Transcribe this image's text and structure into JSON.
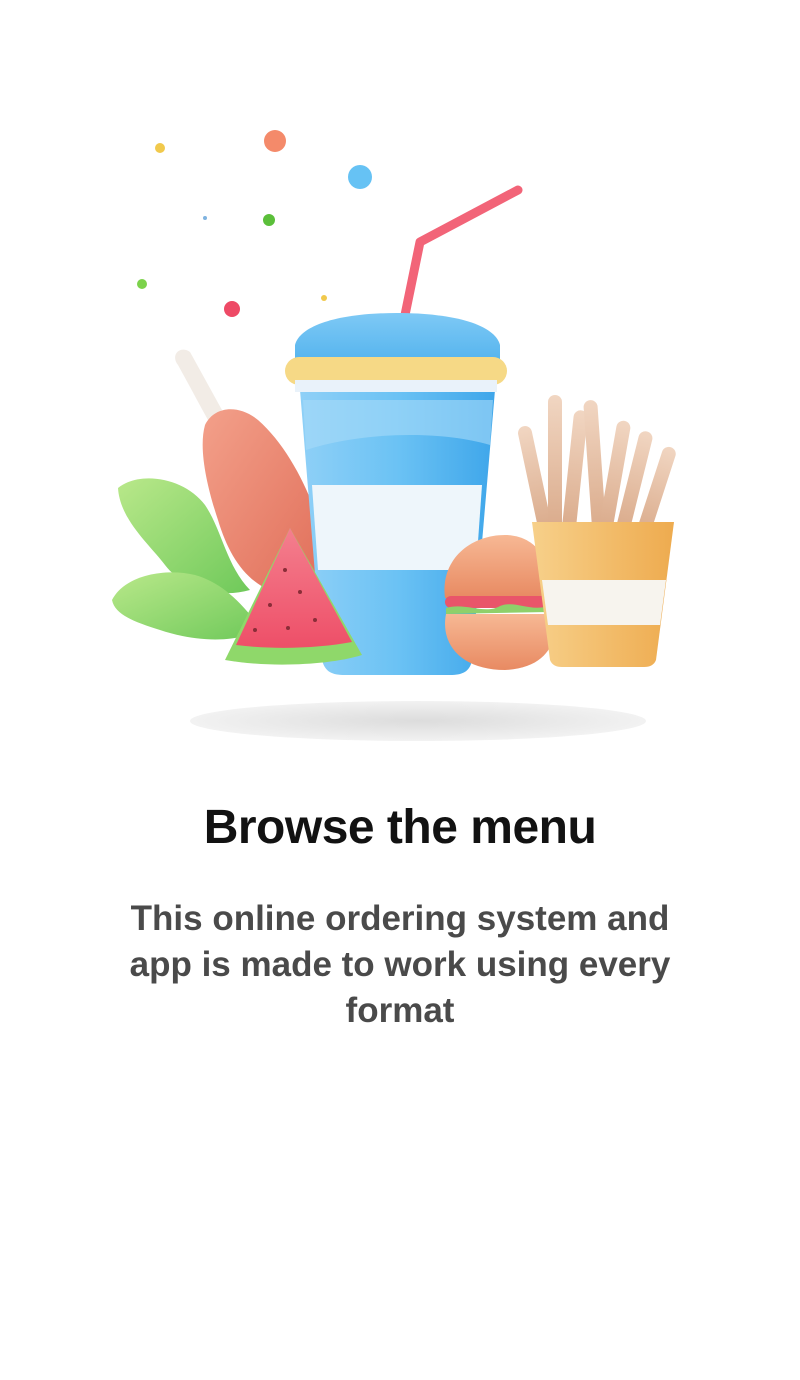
{
  "onboarding": {
    "title": "Browse the menu",
    "description": "This online ordering system and app is made to work using every format"
  },
  "illustration": {
    "items": [
      "confetti-dots",
      "leaf-icon",
      "chicken-leg-icon",
      "watermelon-slice-icon",
      "drink-cup-icon",
      "straw-icon",
      "burger-icon",
      "fries-icon",
      "shadow"
    ]
  },
  "colors": {
    "background": "#ffffff",
    "title": "#121212",
    "subtitle": "#4a4a4a",
    "cup_blue": "#5bb8f0",
    "straw": "#f06b7a",
    "lid_rim": "#f5d57a",
    "leaf_green": "#8fd46a",
    "chicken": "#ef8a72",
    "watermelon": "#f2657a",
    "fries": "#e9bfa0",
    "fries_box": "#f4c26b",
    "bun": "#f5a57e"
  }
}
